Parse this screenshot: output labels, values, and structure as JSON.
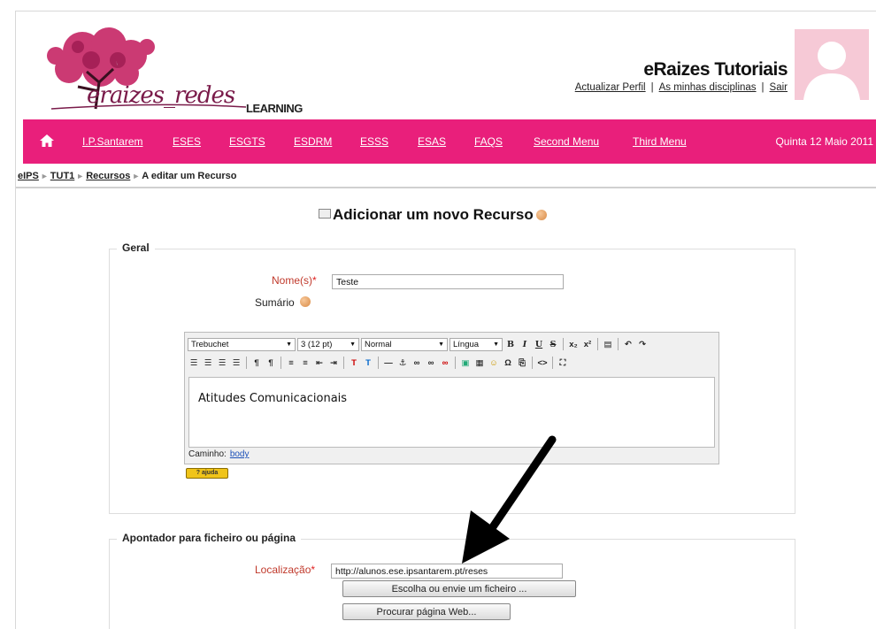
{
  "header": {
    "logo_text": "eraizes_redes",
    "logo_sub": "LEARNING",
    "site_title": "eRaizes Tutoriais",
    "user_links": [
      "Actualizar Perfil",
      "As minhas disciplinas",
      "Sair"
    ]
  },
  "nav": {
    "items": [
      "I.P.Santarem",
      "ESES",
      "ESGTS",
      "ESDRM",
      "ESSS",
      "ESAS",
      "FAQS",
      "Second Menu",
      "Third Menu"
    ],
    "date": "Quinta 12 Maio 2011"
  },
  "breadcrumb": [
    "eIPS",
    "TUT1",
    "Recursos",
    "A editar um Recurso"
  ],
  "page_title": "Adicionar um novo Recurso",
  "general": {
    "legend": "Geral",
    "name_label": "Nome(s)",
    "name_value": "Teste",
    "summary_label": "Sumário"
  },
  "editor": {
    "font": "Trebuchet",
    "size": "3 (12 pt)",
    "format": "Normal",
    "lang": "Língua",
    "content": "Atitudes Comunicacionais",
    "path_label": "Caminho:",
    "path_value": "body"
  },
  "pointer": {
    "legend": "Apontador para ficheiro ou página",
    "location_label": "Localização",
    "location_value": "http://alunos.ese.ipsantarem.pt/reses",
    "choose_button": "Escolha ou envie um ficheiro ...",
    "search_button": "Procurar página Web..."
  },
  "colors": {
    "nav_bar": "#e91f7b",
    "required_label": "#c0392b"
  }
}
